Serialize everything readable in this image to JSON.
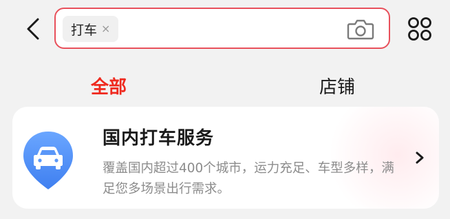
{
  "search": {
    "chip_label": "打车",
    "chip_close_glyph": "×"
  },
  "icons": {
    "back": "chevron-left-icon",
    "camera": "camera-icon",
    "more": "four-circles-grid-icon",
    "service": "car-location-pin-icon",
    "arrow": "chevron-right-icon"
  },
  "tabs": [
    {
      "label": "全部",
      "active": true
    },
    {
      "label": "店铺",
      "active": false
    }
  ],
  "result_card": {
    "title": "国内打车服务",
    "description": "覆盖国内超过400个城市，运力充足、车型多样，满足您多场景出行需求。"
  },
  "colors": {
    "accent_red": "#ef2a1f",
    "search_border": "#e8505b",
    "pin_blue": "#4f8ef7",
    "page_background": "#f2f2f2"
  }
}
